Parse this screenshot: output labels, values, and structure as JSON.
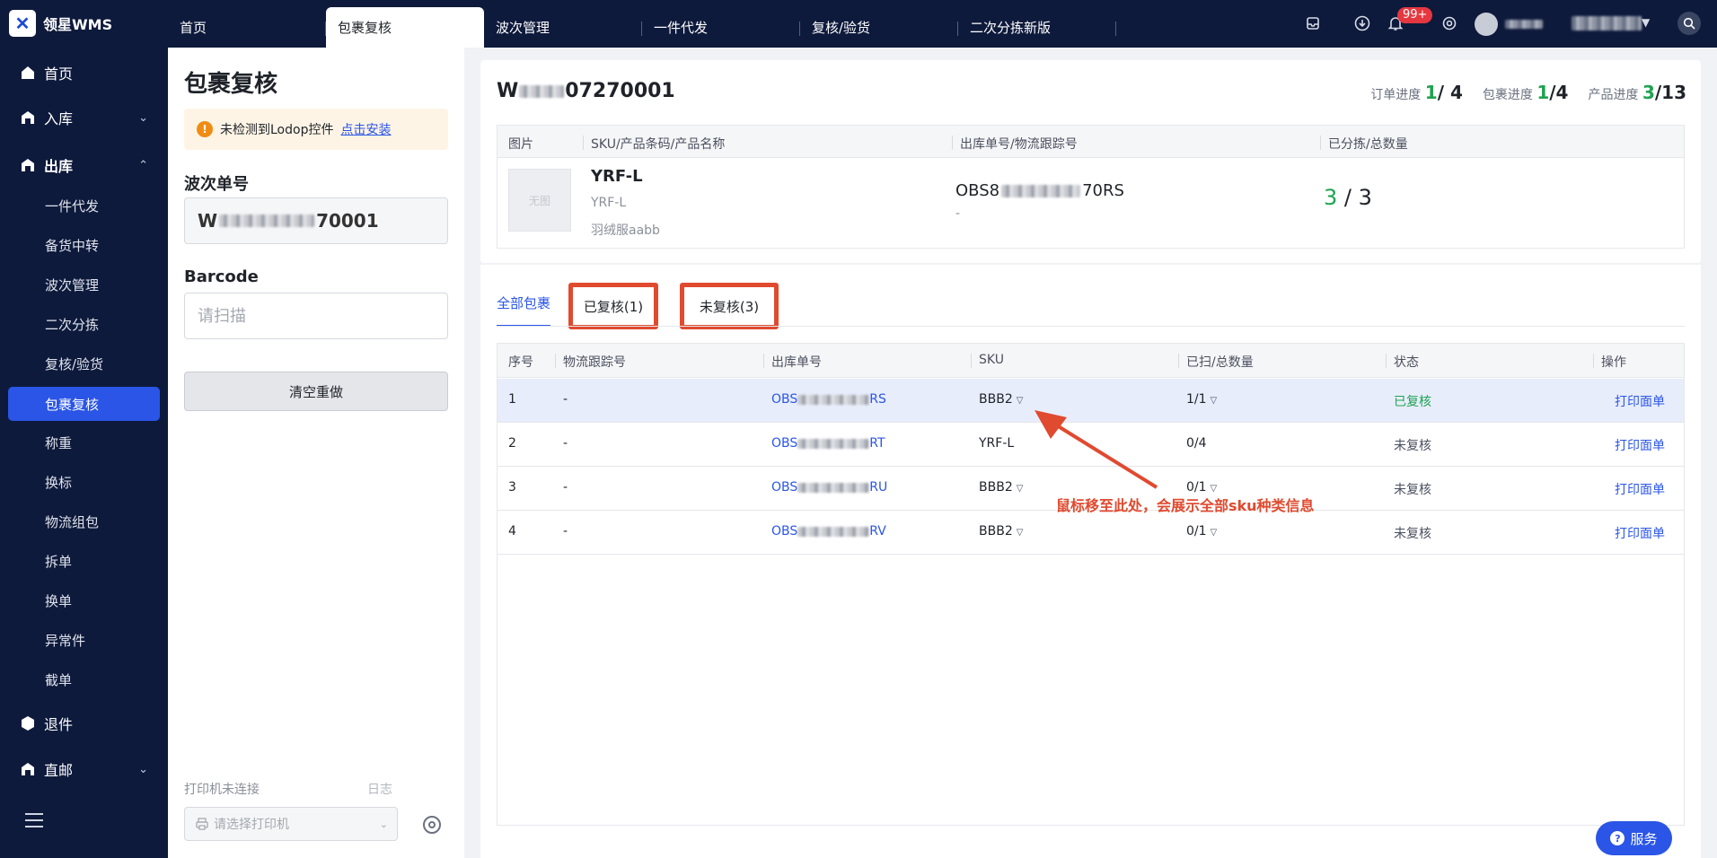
{
  "app": {
    "name": "领星WMS"
  },
  "top_tabs": [
    {
      "label": "首页"
    },
    {
      "label": "包裹复核"
    },
    {
      "label": "波次管理"
    },
    {
      "label": "一件代发"
    },
    {
      "label": "复核/验货"
    },
    {
      "label": "二次分拣新版"
    }
  ],
  "top_right": {
    "notification_count": "99+"
  },
  "sidebar": {
    "home": "首页",
    "inbound": "入库",
    "outbound": "出库",
    "outbound_items": [
      "一件代发",
      "备货中转",
      "波次管理",
      "二次分拣",
      "复核/验货",
      "包裹复核",
      "称重",
      "换标",
      "物流组包",
      "拆单",
      "换单",
      "异常件",
      "截单"
    ],
    "returns": "退件",
    "direct_mail": "直邮"
  },
  "left_panel": {
    "title": "包裹复核",
    "alert_text": "未检测到Lodop控件",
    "alert_link": "点击安装",
    "wave_label": "波次单号",
    "wave_value_prefix": "W",
    "wave_value_suffix": "70001",
    "barcode_label": "Barcode",
    "barcode_placeholder": "请扫描",
    "clear_button": "清空重做",
    "printer_status": "打印机未连接",
    "log_link": "日志",
    "printer_placeholder": "请选择打印机"
  },
  "summary": {
    "wave_no_prefix": "W",
    "wave_no_suffix": "07270001",
    "order_progress_label": "订单进度",
    "order_done": "1",
    "order_total": "/ 4",
    "package_progress_label": "包裹进度",
    "package_done": "1",
    "package_total": "/4",
    "product_progress_label": "产品进度",
    "product_done": "3",
    "product_total": "/13",
    "columns": [
      "图片",
      "SKU/产品条码/产品名称",
      "出库单号/物流跟踪号",
      "已分拣/总数量"
    ],
    "thumb_text": "无图",
    "sku": "YRF-L",
    "barcode": "YRF-L",
    "product_name": "羽绒服aabb",
    "out_no_prefix": "OBS8",
    "out_no_suffix": "70RS",
    "tracking": "-",
    "sorted_done": "3",
    "sorted_total": " / 3"
  },
  "package_tabs": {
    "all": "全部包裹",
    "reviewed": "已复核(1)",
    "unreviewed": "未复核(3)"
  },
  "package_table": {
    "columns": [
      "序号",
      "物流跟踪号",
      "出库单号",
      "SKU",
      "已扫/总数量",
      "状态",
      "操作"
    ],
    "rows": [
      {
        "idx": "1",
        "tracking": "-",
        "out_prefix": "OBS",
        "out_suffix": "RS",
        "sku": "BBB2",
        "qty": "1/1",
        "status": "已复核",
        "action": "打印面单"
      },
      {
        "idx": "2",
        "tracking": "-",
        "out_prefix": "OBS",
        "out_suffix": "RT",
        "sku": "YRF-L",
        "qty": "0/4",
        "status": "未复核",
        "action": "打印面单"
      },
      {
        "idx": "3",
        "tracking": "-",
        "out_prefix": "OBS",
        "out_suffix": "RU",
        "sku": "BBB2",
        "qty": "0/1",
        "status": "未复核",
        "action": "打印面单"
      },
      {
        "idx": "4",
        "tracking": "-",
        "out_prefix": "OBS",
        "out_suffix": "RV",
        "sku": "BBB2",
        "qty": "0/1",
        "status": "未复核",
        "action": "打印面单"
      }
    ]
  },
  "annotation": "鼠标移至此处，会展示全部sku种类信息",
  "service_button": "服务",
  "colors": {
    "primary": "#2a55e6",
    "nav_bg": "#0e1a3c",
    "success": "#1fa352",
    "highlight_border": "#e04a2f"
  }
}
